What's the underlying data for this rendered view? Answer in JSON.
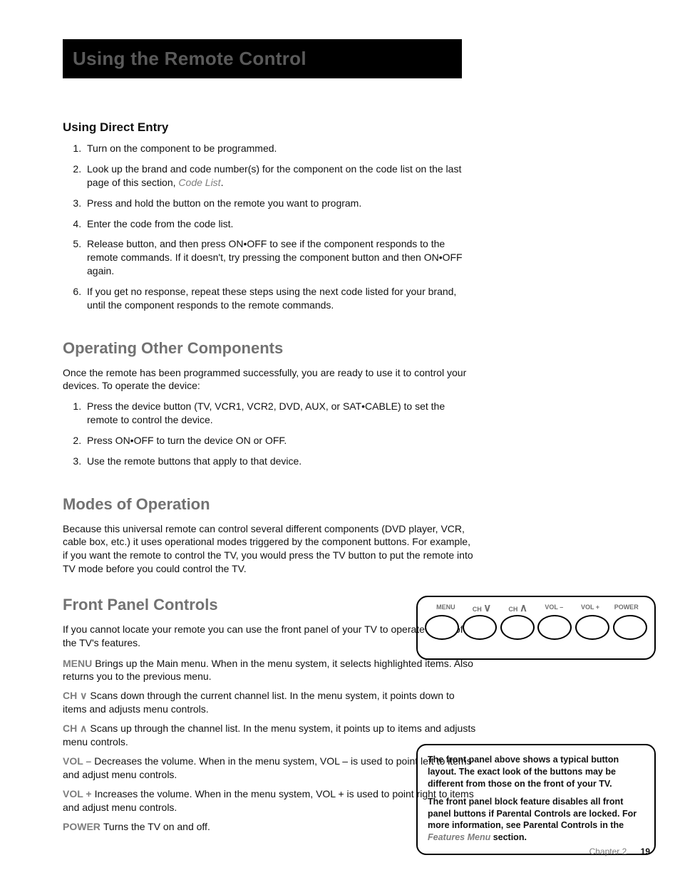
{
  "header": {
    "title": "Using the Remote Control"
  },
  "sections": {
    "direct_entry": {
      "heading": "Using Direct Entry",
      "items": [
        "Turn on the component to be programmed.",
        "Look up the brand and code number(s) for the component on the code list on the last page of this section, ",
        "Press and hold the button on the remote you want to program.",
        "Enter the code from the code list.",
        "Release button, and then press ON•OFF to see if the component responds to the remote commands. If it doesn't, try pressing the component button and then ON•OFF again.",
        "If you get no response, repeat these steps using the next code listed for your brand, until the component responds to the remote commands."
      ],
      "codelist_italic": "Code List"
    },
    "operating": {
      "heading": "Operating Other Components",
      "intro": "Once the remote has been programmed successfully, you are ready to use it to control your devices. To operate the device:",
      "items": [
        "Press the device button (TV, VCR1, VCR2, DVD, AUX, or SAT•CABLE) to set the remote to control the device.",
        "Press ON•OFF to turn the device ON or OFF.",
        "Use the remote buttons that apply to that device."
      ]
    },
    "modes": {
      "heading": "Modes of Operation",
      "para": "Because this universal remote can control several different components (DVD player, VCR, cable box, etc.) it uses operational modes triggered by the component buttons. For example, if you want the remote to control the TV, you would press the TV button to put the remote into TV mode before you could control the TV."
    },
    "frontpanel": {
      "heading": "Front Panel Controls",
      "intro": "If you cannot locate your remote you can use the front panel of your TV to operate many of the TV's features.",
      "terms": [
        {
          "term": "MENU",
          "desc": "Brings up the Main menu. When in the menu system, it selects highlighted items. Also returns you to the previous menu."
        },
        {
          "term": "CH ∨",
          "desc": "Scans down through the current channel list. In the menu system, it points down to items and adjusts menu controls."
        },
        {
          "term": "CH ∧",
          "desc": "Scans up through the channel list. In the menu system, it points up to items and adjusts menu controls."
        },
        {
          "term": "VOL –",
          "desc": "Decreases the volume. When in the menu system, VOL – is used to point left to items and adjust menu controls."
        },
        {
          "term": "VOL +",
          "desc": "Increases the volume. When in the menu system, VOL + is used to point right to items and adjust menu controls."
        },
        {
          "term": "POWER",
          "desc": "Turns the TV on and off."
        }
      ]
    }
  },
  "diagram": {
    "labels": [
      "MENU",
      "CH",
      "CH",
      "VOL –",
      "VOL +",
      "POWER"
    ]
  },
  "side_note": {
    "p1": "The front panel above shows a typical button layout. The exact look of the buttons may be different from those on the front of your TV.",
    "p2a": "The front panel block feature disables all front panel buttons if Parental Controls are locked. For more information, see Parental Controls in the ",
    "p2_italic": "Features Menu",
    "p2b": " section."
  },
  "footer": {
    "label": "Chapter 2",
    "page": "19"
  }
}
